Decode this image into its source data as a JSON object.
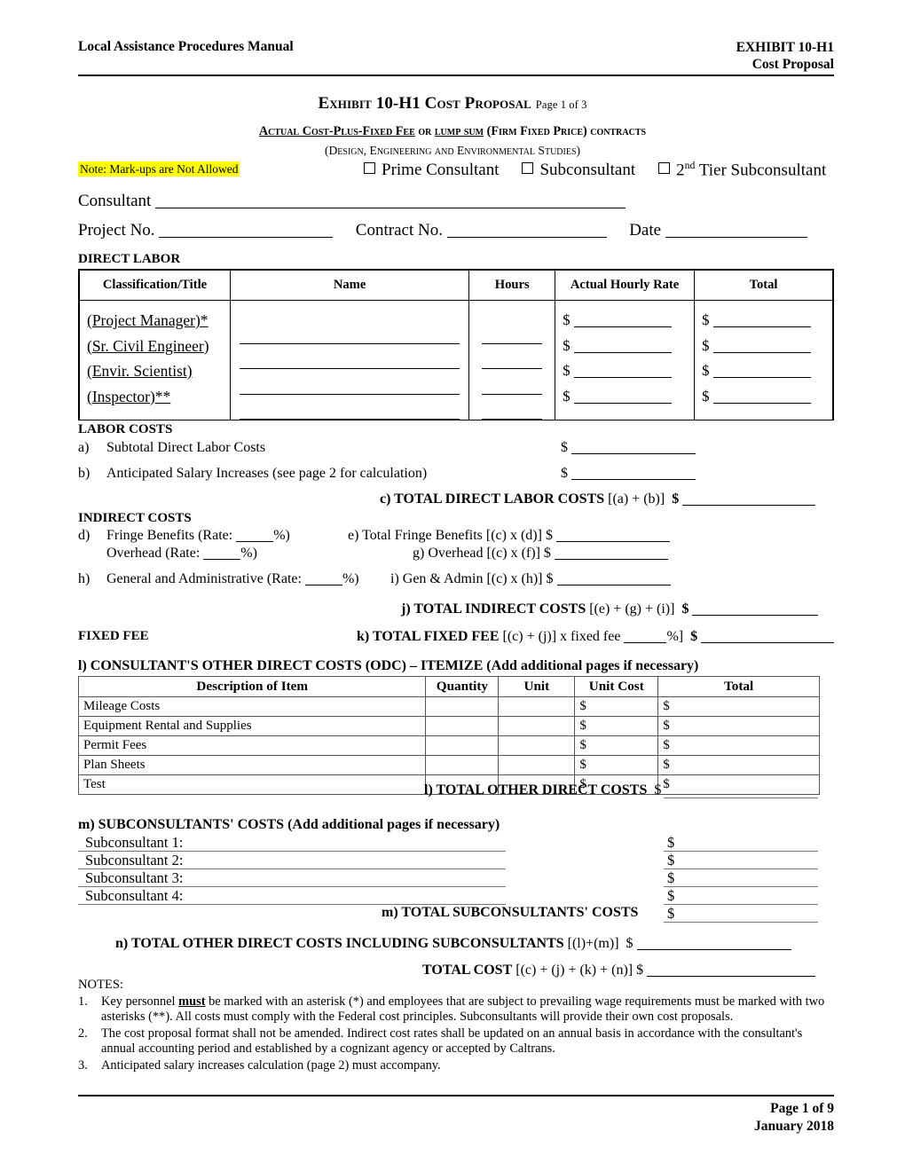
{
  "header": {
    "left": "Local Assistance Procedures Manual",
    "right_line1": "EXHIBIT 10-H1",
    "right_line2": "Cost Proposal"
  },
  "title": {
    "main": "Exhibit 10-H1 Cost Proposal",
    "page_of": "Page 1 of 3",
    "subtitle1_a": "Actual Cost-Plus-Fixed Fee",
    "subtitle1_b": " or ",
    "subtitle1_c": "lump sum",
    "subtitle1_d": " (Firm Fixed Price) contracts",
    "subtitle2": "(Design, Engineering and Environmental Studies)"
  },
  "note": {
    "text": "Note: Mark-ups are Not Allowed",
    "highlight_color": "#FFFF00"
  },
  "consultant_type": {
    "options": [
      {
        "label": "Prime Consultant",
        "checked": false
      },
      {
        "label": "Subconsultant",
        "checked": false
      },
      {
        "label": "2nd Tier Subconsultant",
        "checked": false,
        "sup": "nd",
        "base": "2",
        "rest": " Tier Subconsultant"
      }
    ]
  },
  "fields": {
    "consultant_label": "Consultant",
    "consultant_value": "",
    "project_no_label": "Project No.",
    "project_no_value": "",
    "contract_no_label": "Contract No.",
    "contract_no_value": "",
    "date_label": "Date",
    "date_value": ""
  },
  "direct_labor": {
    "heading": "DIRECT LABOR",
    "columns": [
      "Classification/Title",
      "Name",
      "Hours",
      "Actual Hourly Rate",
      "Total"
    ],
    "rows": [
      {
        "classification": "(Project Manager)*",
        "name": "",
        "hours": "",
        "rate_prefix": "$",
        "rate": "",
        "total_prefix": "$",
        "total": ""
      },
      {
        "classification": "(Sr. Civil Engineer)",
        "name": "",
        "hours": "",
        "rate_prefix": "$",
        "rate": "",
        "total_prefix": "$",
        "total": ""
      },
      {
        "classification": "(Envir. Scientist)",
        "name": "",
        "hours": "",
        "rate_prefix": "$",
        "rate": "",
        "total_prefix": "$",
        "total": ""
      },
      {
        "classification": "(Inspector)**",
        "name": "",
        "hours": "",
        "rate_prefix": "$",
        "rate": "",
        "total_prefix": "$",
        "total": ""
      }
    ]
  },
  "labor_costs": {
    "heading": "LABOR COSTS",
    "a_marker": "a)",
    "a_label": "Subtotal Direct Labor Costs",
    "a_dollar": "$",
    "b_marker": "b)",
    "b_label": "Anticipated Salary Increases (see page 2 for calculation)",
    "b_dollar": "$",
    "c_label_bold": "c) TOTAL DIRECT LABOR COSTS",
    "c_label_plain": " [(a) + (b)]",
    "c_dollar": "$"
  },
  "indirect_costs": {
    "heading": "INDIRECT COSTS",
    "d_marker": "d)",
    "d_label_pre": "Fringe Benefits (Rate:",
    "d_rate": "",
    "d_label_post": "%)",
    "e_label": "e) Total Fringe Benefits [(c) x (d)]",
    "e_dollar": "$",
    "f_label_pre": "Overhead (Rate:",
    "f_rate": "",
    "f_label_post": "%)",
    "g_label": "g) Overhead [(c) x (f)]",
    "g_dollar": "$",
    "h_marker": "h)",
    "h_label_pre": "General and Administrative (Rate:",
    "h_rate": "",
    "h_label_post": "%)",
    "i_label": "i) Gen & Admin [(c) x (h)]",
    "i_dollar": "$",
    "j_label_bold": "j) TOTAL INDIRECT COSTS",
    "j_label_plain": " [(e) + (g) + (i)]",
    "j_dollar": "$"
  },
  "fixed_fee": {
    "heading": "FIXED FEE",
    "k_label_bold": "k) TOTAL FIXED FEE",
    "k_label_plain_1": " [(c) + (j)] x fixed fee ",
    "k_rate": "",
    "k_label_plain_2": "%]",
    "k_dollar": "$"
  },
  "odc": {
    "heading_bold": "l) CONSULTANT'S OTHER DIRECT COSTS (ODC) – ITEMIZE (Add additional pages if necessary)",
    "columns": [
      "Description of Item",
      "Quantity",
      "Unit",
      "Unit Cost",
      "Total"
    ],
    "rows": [
      {
        "description": "Mileage Costs",
        "quantity": "",
        "unit": "",
        "unit_cost": "$",
        "total": "$"
      },
      {
        "description": "Equipment Rental and Supplies",
        "quantity": "",
        "unit": "",
        "unit_cost": "$",
        "total": "$"
      },
      {
        "description": "Permit Fees",
        "quantity": "",
        "unit": "",
        "unit_cost": "$",
        "total": "$"
      },
      {
        "description": "Plan Sheets",
        "quantity": "",
        "unit": "",
        "unit_cost": "$",
        "total": "$"
      },
      {
        "description": "Test",
        "quantity": "",
        "unit": "",
        "unit_cost": "$",
        "total": "$"
      }
    ],
    "total_label": "l) TOTAL OTHER DIRECT COSTS",
    "total_dollar": "$"
  },
  "subconsultants": {
    "heading": "m) SUBCONSULTANTS' COSTS (Add additional pages if necessary)",
    "rows": [
      {
        "label": "Subconsultant 1:",
        "value": "",
        "dollar": "$"
      },
      {
        "label": "Subconsultant 2:",
        "value": "",
        "dollar": "$"
      },
      {
        "label": "Subconsultant 3:",
        "value": "",
        "dollar": "$"
      },
      {
        "label": "Subconsultant 4:",
        "value": "",
        "dollar": "$"
      }
    ],
    "total_label": "m) TOTAL SUBCONSULTANTS' COSTS",
    "total_dollar": "$"
  },
  "totals": {
    "n_label_bold": "n) TOTAL OTHER DIRECT COSTS INCLUDING SUBCONSULTANTS",
    "n_label_plain": " [(l)+(m)]",
    "n_dollar": "$",
    "total_label_bold": "TOTAL COST",
    "total_label_plain": " [(c) + (j) + (k) + (n)] $"
  },
  "notes": {
    "heading": "NOTES:",
    "items": [
      {
        "num": "1.",
        "pre": "Key personnel ",
        "bold_underline": "must",
        "post": " be marked with an asterisk (*) and employees that are subject to prevailing wage requirements must be marked with two asterisks (**). All costs must comply with the Federal cost principles. Subconsultants will provide their own cost proposals."
      },
      {
        "num": "2.",
        "pre": "",
        "bold_underline": "",
        "post": "The cost proposal format shall not be amended. Indirect cost rates shall be updated on an annual basis in accordance with the consultant's annual accounting period and established by a cognizant agency or accepted by Caltrans."
      },
      {
        "num": "3.",
        "pre": "",
        "bold_underline": "",
        "post": "Anticipated salary increases calculation (page 2) must accompany."
      }
    ]
  },
  "footer": {
    "page": "Page 1 of 9",
    "date": "January 2018"
  }
}
